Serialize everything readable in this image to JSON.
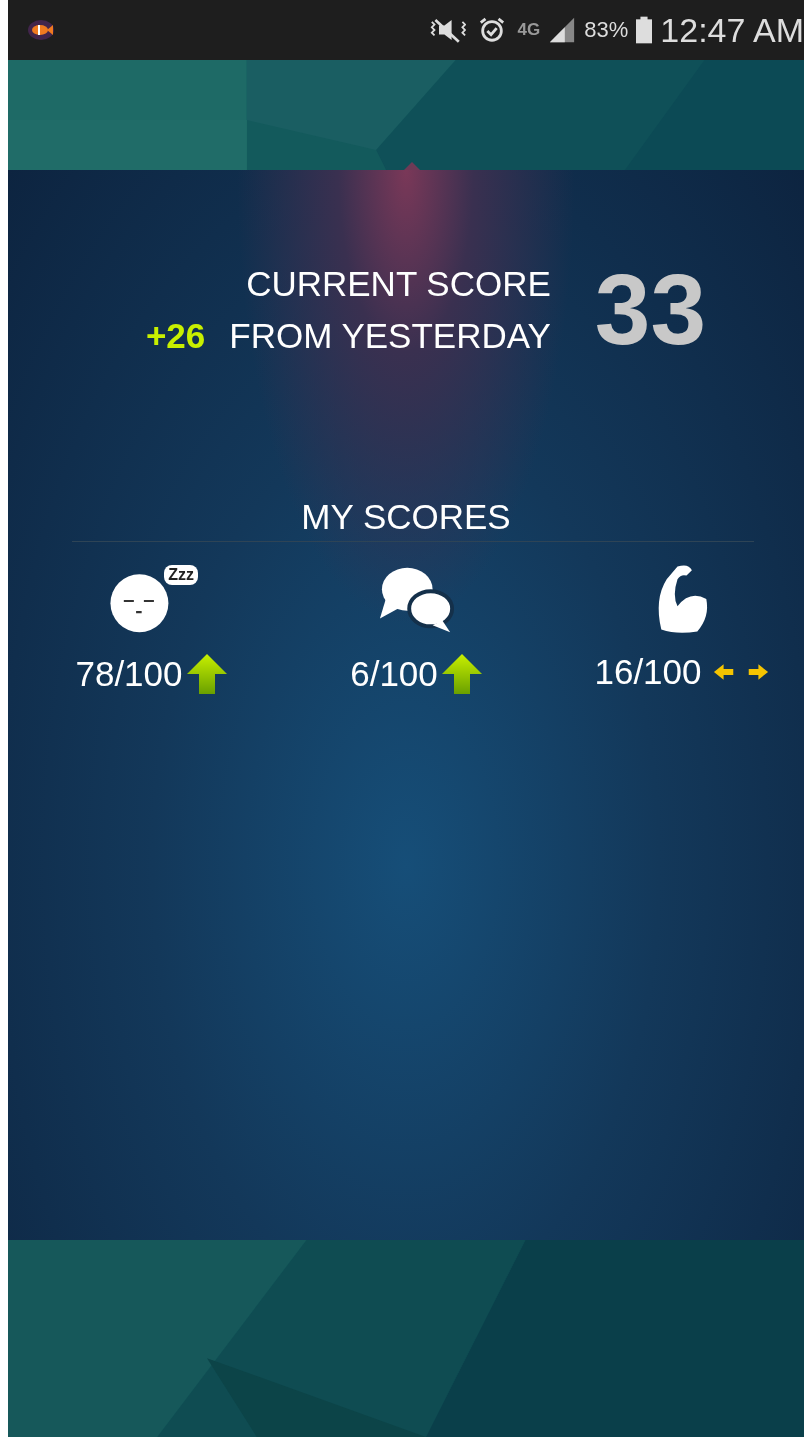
{
  "status_bar": {
    "network": "4G",
    "battery": "83%",
    "time": "12:47 AM"
  },
  "current_score": {
    "label": "CURRENT SCORE",
    "change": "+26",
    "change_label": "FROM YESTERDAY",
    "value": "33"
  },
  "my_scores": {
    "title": "MY SCORES",
    "items": [
      {
        "kind": "sleep",
        "badge": "Zzz",
        "score": "78/100",
        "rising": true
      },
      {
        "kind": "social",
        "score": "6/100",
        "rising": true
      },
      {
        "kind": "fitness",
        "score": "16/100",
        "rising": false
      }
    ]
  }
}
